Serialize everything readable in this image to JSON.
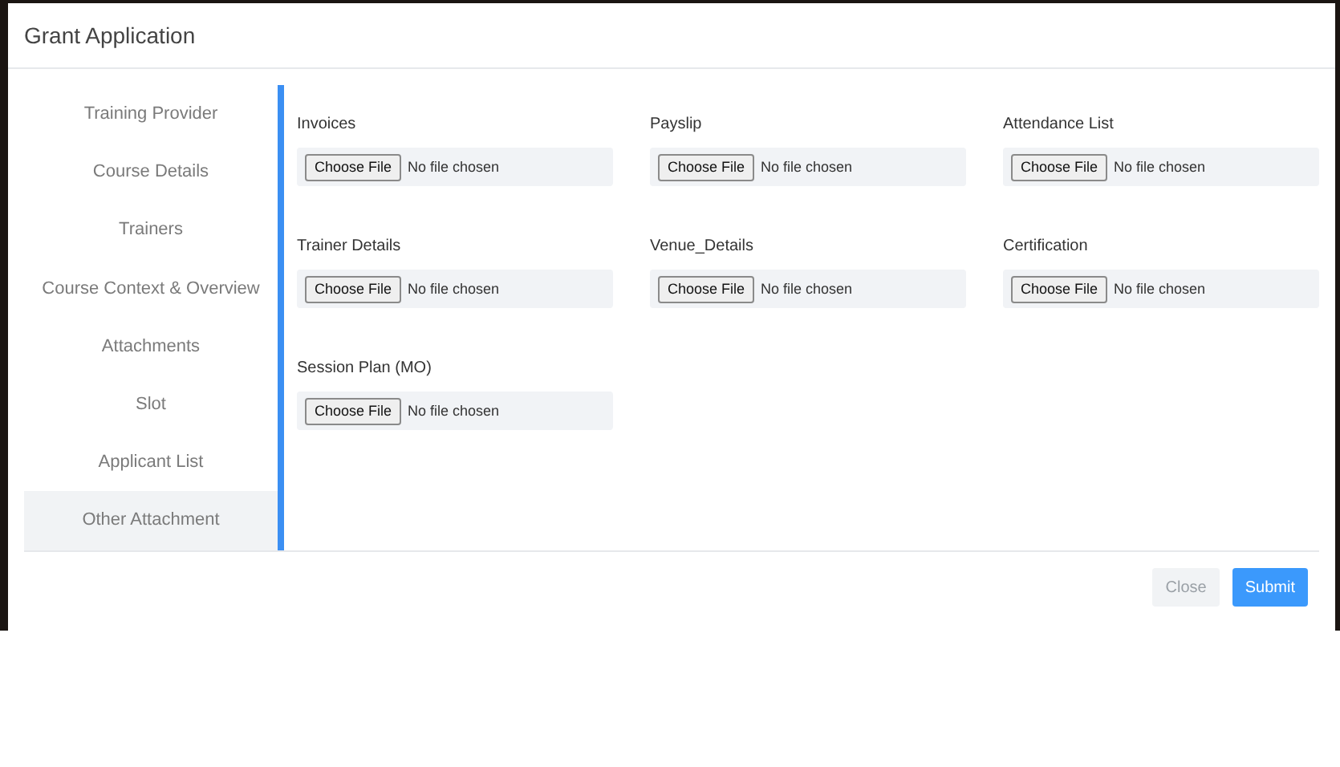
{
  "dialog": {
    "title": "Grant Application"
  },
  "sidebar": {
    "items": [
      {
        "label": "Training Provider",
        "selected": false
      },
      {
        "label": "Course Details",
        "selected": false
      },
      {
        "label": "Trainers",
        "selected": false
      },
      {
        "label": "Course Context & Overview",
        "selected": false
      },
      {
        "label": "Attachments",
        "selected": false
      },
      {
        "label": "Slot",
        "selected": false
      },
      {
        "label": "Applicant List",
        "selected": false
      },
      {
        "label": "Other Attachment",
        "selected": true
      }
    ]
  },
  "fields": [
    {
      "label": "Invoices",
      "button": "Choose File",
      "status": "No file chosen"
    },
    {
      "label": "Payslip",
      "button": "Choose File",
      "status": "No file chosen"
    },
    {
      "label": "Attendance List",
      "button": "Choose File",
      "status": "No file chosen"
    },
    {
      "label": "Trainer Details",
      "button": "Choose File",
      "status": "No file chosen"
    },
    {
      "label": "Venue_Details",
      "button": "Choose File",
      "status": "No file chosen"
    },
    {
      "label": "Certification",
      "button": "Choose File",
      "status": "No file chosen"
    },
    {
      "label": "Session Plan (MO)",
      "button": "Choose File",
      "status": "No file chosen"
    }
  ],
  "footer": {
    "buttons": [
      {
        "label": "Close",
        "kind": "secondary"
      },
      {
        "label": "Submit",
        "kind": "primary"
      }
    ]
  }
}
